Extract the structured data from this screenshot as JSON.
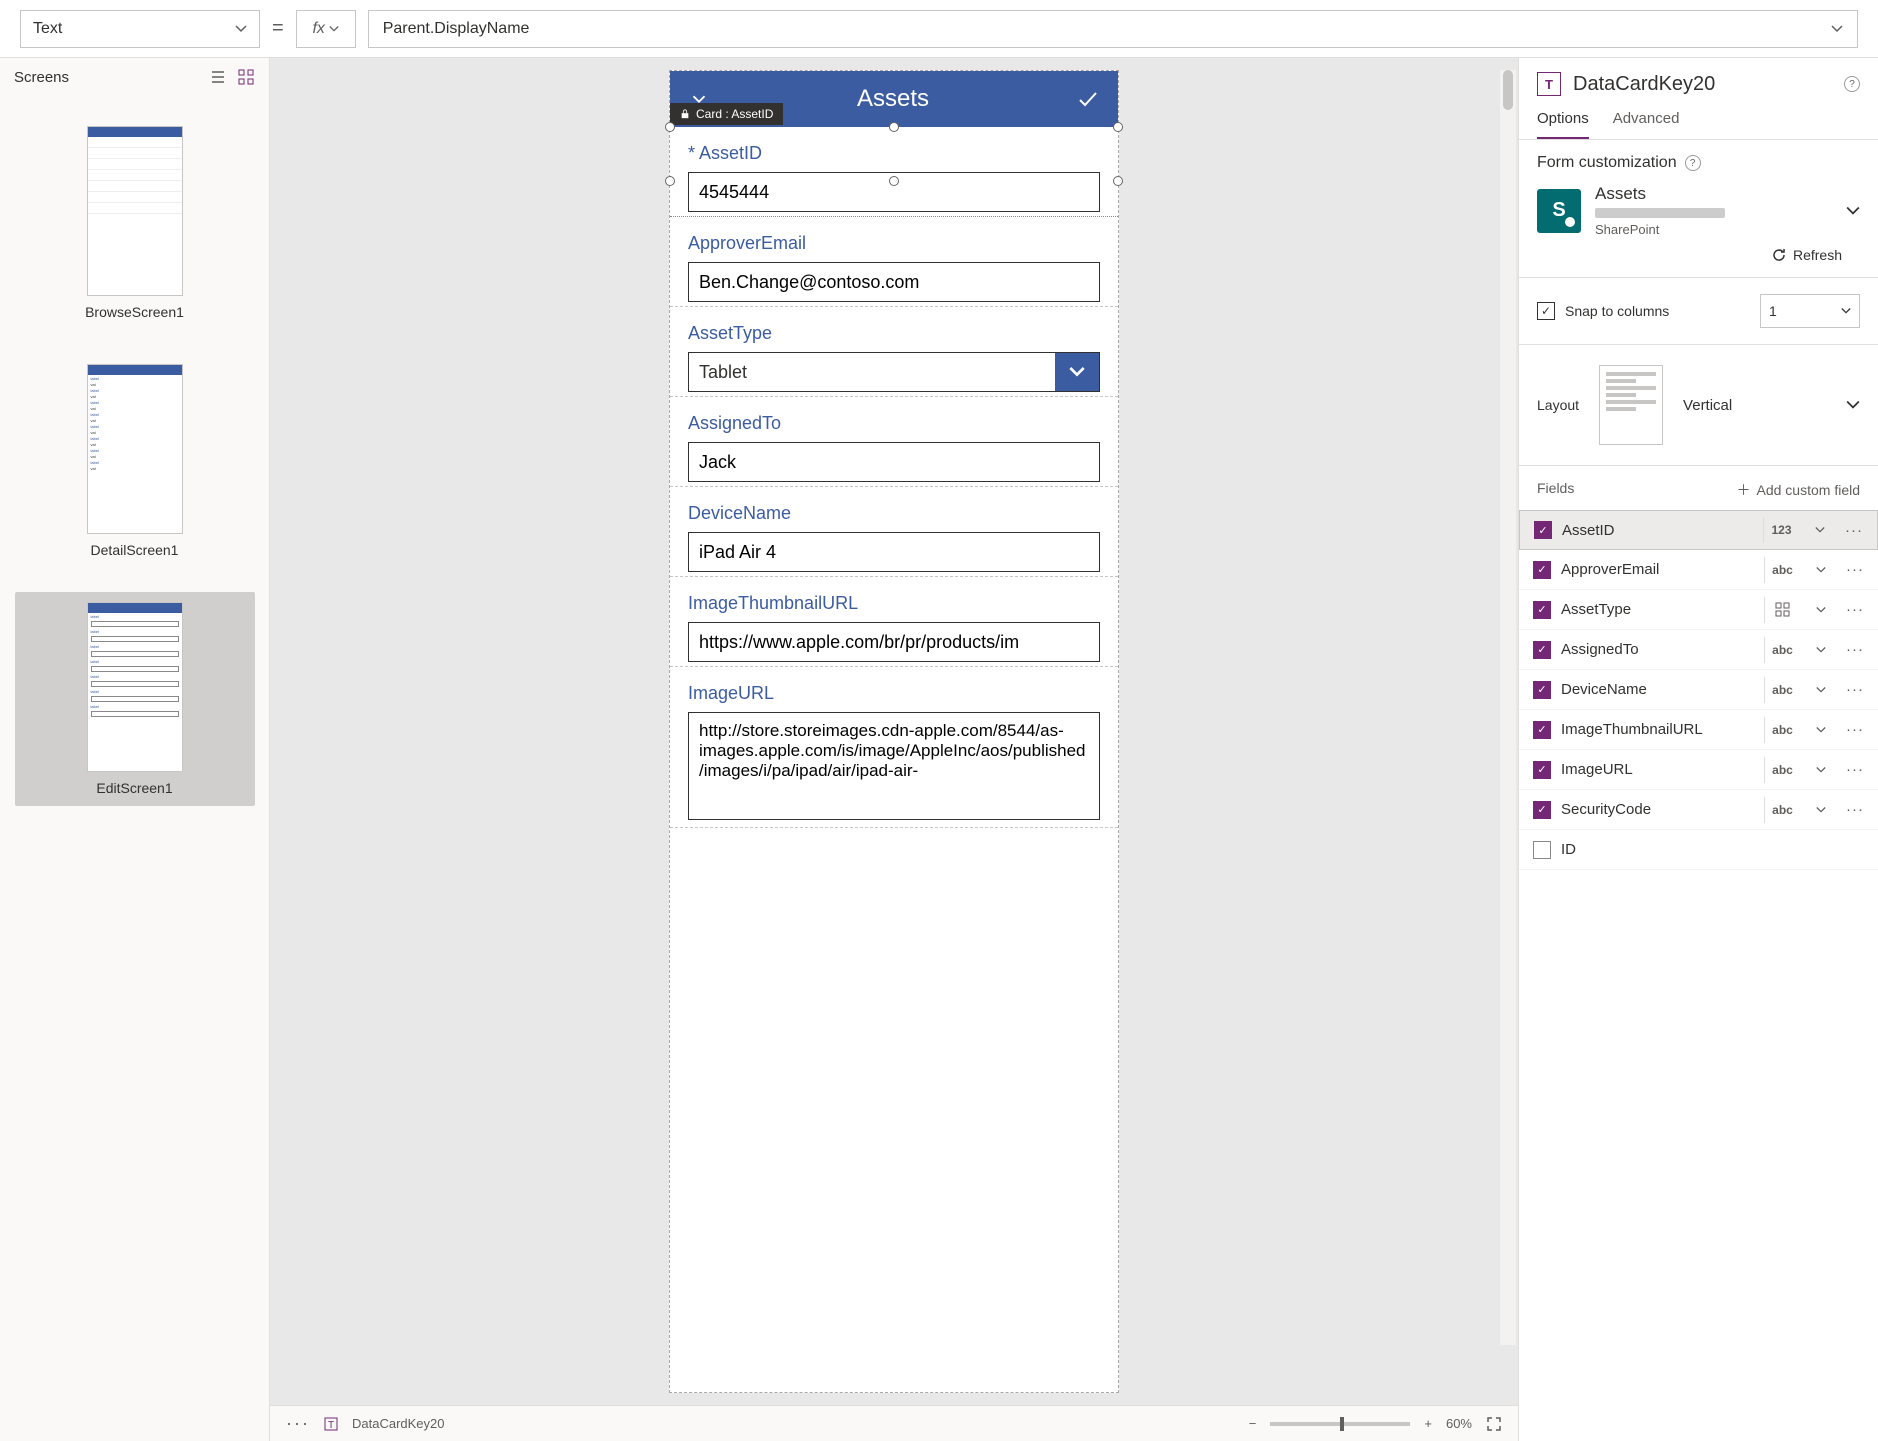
{
  "formula_bar": {
    "property": "Text",
    "fx_label": "fx",
    "expression": "Parent.DisplayName"
  },
  "screens_panel": {
    "title": "Screens",
    "screens": [
      {
        "name": "BrowseScreen1"
      },
      {
        "name": "DetailScreen1"
      },
      {
        "name": "EditScreen1"
      }
    ],
    "selected": "EditScreen1"
  },
  "canvas": {
    "header_title": "Assets",
    "tooltip": "Card : AssetID",
    "cards": [
      {
        "key": "AssetID",
        "label": "AssetID",
        "required": true,
        "type": "text",
        "value": "4545444",
        "selected": true
      },
      {
        "key": "ApproverEmail",
        "label": "ApproverEmail",
        "required": false,
        "type": "text",
        "value": "Ben.Change@contoso.com"
      },
      {
        "key": "AssetType",
        "label": "AssetType",
        "required": false,
        "type": "select",
        "value": "Tablet"
      },
      {
        "key": "AssignedTo",
        "label": "AssignedTo",
        "required": false,
        "type": "text",
        "value": "Jack"
      },
      {
        "key": "DeviceName",
        "label": "DeviceName",
        "required": false,
        "type": "text",
        "value": "iPad Air 4"
      },
      {
        "key": "ImageThumbnailURL",
        "label": "ImageThumbnailURL",
        "required": false,
        "type": "text",
        "value": "https://www.apple.com/br/pr/products/im"
      },
      {
        "key": "ImageURL",
        "label": "ImageURL",
        "required": false,
        "type": "textarea",
        "value": "http://store.storeimages.cdn-apple.com/8544/as-images.apple.com/is/image/AppleInc/aos/published/images/i/pa/ipad/air/ipad-air-"
      }
    ]
  },
  "status_bar": {
    "breadcrumb": "DataCardKey20",
    "zoom": "60%"
  },
  "right_panel": {
    "element_name": "DataCardKey20",
    "tabs": {
      "options": "Options",
      "advanced": "Advanced",
      "active": "options"
    },
    "form_customization": "Form customization",
    "data_source": {
      "name": "Assets",
      "type": "SharePoint"
    },
    "refresh": "Refresh",
    "snap_label": "Snap to columns",
    "snap_checked": true,
    "snap_columns": "1",
    "layout_label": "Layout",
    "layout_value": "Vertical",
    "fields_label": "Fields",
    "add_custom": "Add custom field",
    "fields": [
      {
        "name": "AssetID",
        "type": "123",
        "checked": true,
        "selected": true
      },
      {
        "name": "ApproverEmail",
        "type": "abc",
        "checked": true
      },
      {
        "name": "AssetType",
        "type": "grid",
        "checked": true
      },
      {
        "name": "AssignedTo",
        "type": "abc",
        "checked": true
      },
      {
        "name": "DeviceName",
        "type": "abc",
        "checked": true
      },
      {
        "name": "ImageThumbnailURL",
        "type": "abc",
        "checked": true
      },
      {
        "name": "ImageURL",
        "type": "abc",
        "checked": true
      },
      {
        "name": "SecurityCode",
        "type": "abc",
        "checked": true
      },
      {
        "name": "ID",
        "type": "",
        "checked": false
      }
    ]
  }
}
